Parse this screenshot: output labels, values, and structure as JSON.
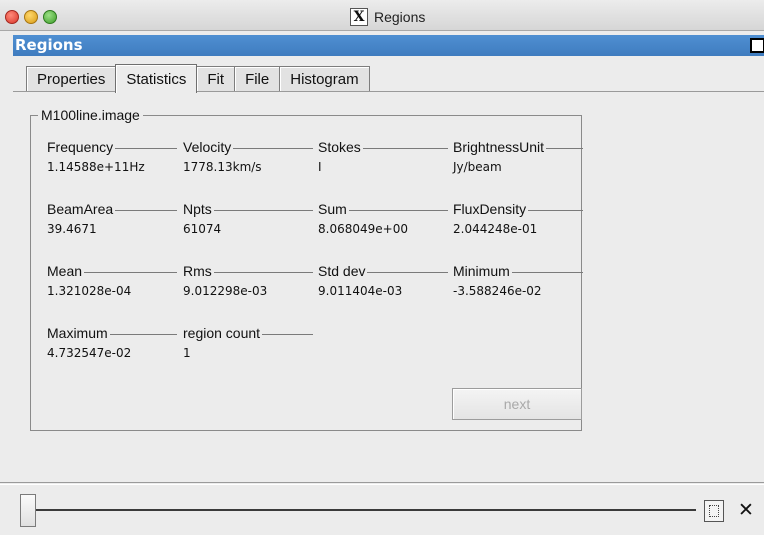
{
  "window": {
    "title": "Regions",
    "x_glyph": "X"
  },
  "header": {
    "title": "Regions",
    "close_glyph": "✕"
  },
  "tabs": [
    {
      "label": "Properties"
    },
    {
      "label": "Statistics",
      "active": true
    },
    {
      "label": "Fit"
    },
    {
      "label": "File"
    },
    {
      "label": "Histogram"
    }
  ],
  "group": {
    "title": "M100line.image",
    "stats": [
      {
        "label": "Frequency",
        "value": "1.14588e+11Hz"
      },
      {
        "label": "Velocity",
        "value": "1778.13km/s"
      },
      {
        "label": "Stokes",
        "value": "I"
      },
      {
        "label": "BrightnessUnit",
        "value": "Jy/beam"
      },
      {
        "label": "BeamArea",
        "value": "39.4671"
      },
      {
        "label": "Npts",
        "value": "61074"
      },
      {
        "label": "Sum",
        "value": "8.068049e+00"
      },
      {
        "label": "FluxDensity",
        "value": "2.044248e-01"
      },
      {
        "label": "Mean",
        "value": "1.321028e-04"
      },
      {
        "label": "Rms",
        "value": "9.012298e-03"
      },
      {
        "label": "Std dev",
        "value": "9.011404e-03"
      },
      {
        "label": "Minimum",
        "value": "-3.588246e-02"
      },
      {
        "label": "Maximum",
        "value": "4.732547e-02"
      },
      {
        "label": "region count",
        "value": "1"
      }
    ],
    "next_label": "next"
  },
  "footer": {
    "close_glyph": "✕"
  },
  "colors": {
    "header_blue": "#3f7cbf"
  }
}
